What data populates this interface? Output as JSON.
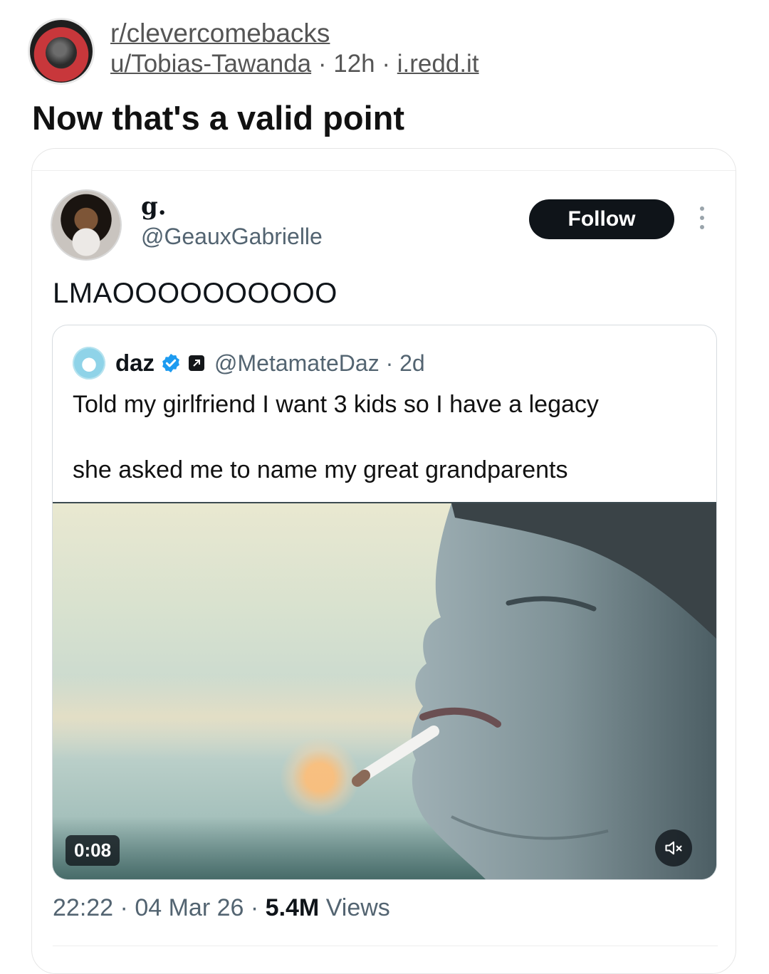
{
  "reddit": {
    "subreddit": "r/clevercomebacks",
    "username": "u/Tobias-Tawanda",
    "separator": "·",
    "age": "12h",
    "domain": "i.redd.it",
    "title": "Now that's a valid point"
  },
  "tweet": {
    "author_name": "g.",
    "author_handle": "@GeauxGabrielle",
    "follow_label": "Follow",
    "text": "LMAOOOOOOOOOO",
    "time": "22:22",
    "date": "04 Mar 26",
    "views_count": "5.4M",
    "views_label": "Views",
    "meta_separator": "·"
  },
  "quote": {
    "author_name": "daz",
    "handle_time": "@MetamateDaz · 2d",
    "line1": "Told my girlfriend I want 3 kids so I have a legacy",
    "line2": "she asked me to name my great grandparents",
    "video_time": "0:08"
  },
  "colors": {
    "follow_button_bg": "#0f1419",
    "verified_blue": "#1d9bf0",
    "muted_text": "#536471"
  },
  "icons": {
    "more": "more-vertical-icon",
    "verified": "verified-badge-icon",
    "affiliate": "affiliate-badge-icon",
    "mute": "speaker-muted-icon"
  }
}
